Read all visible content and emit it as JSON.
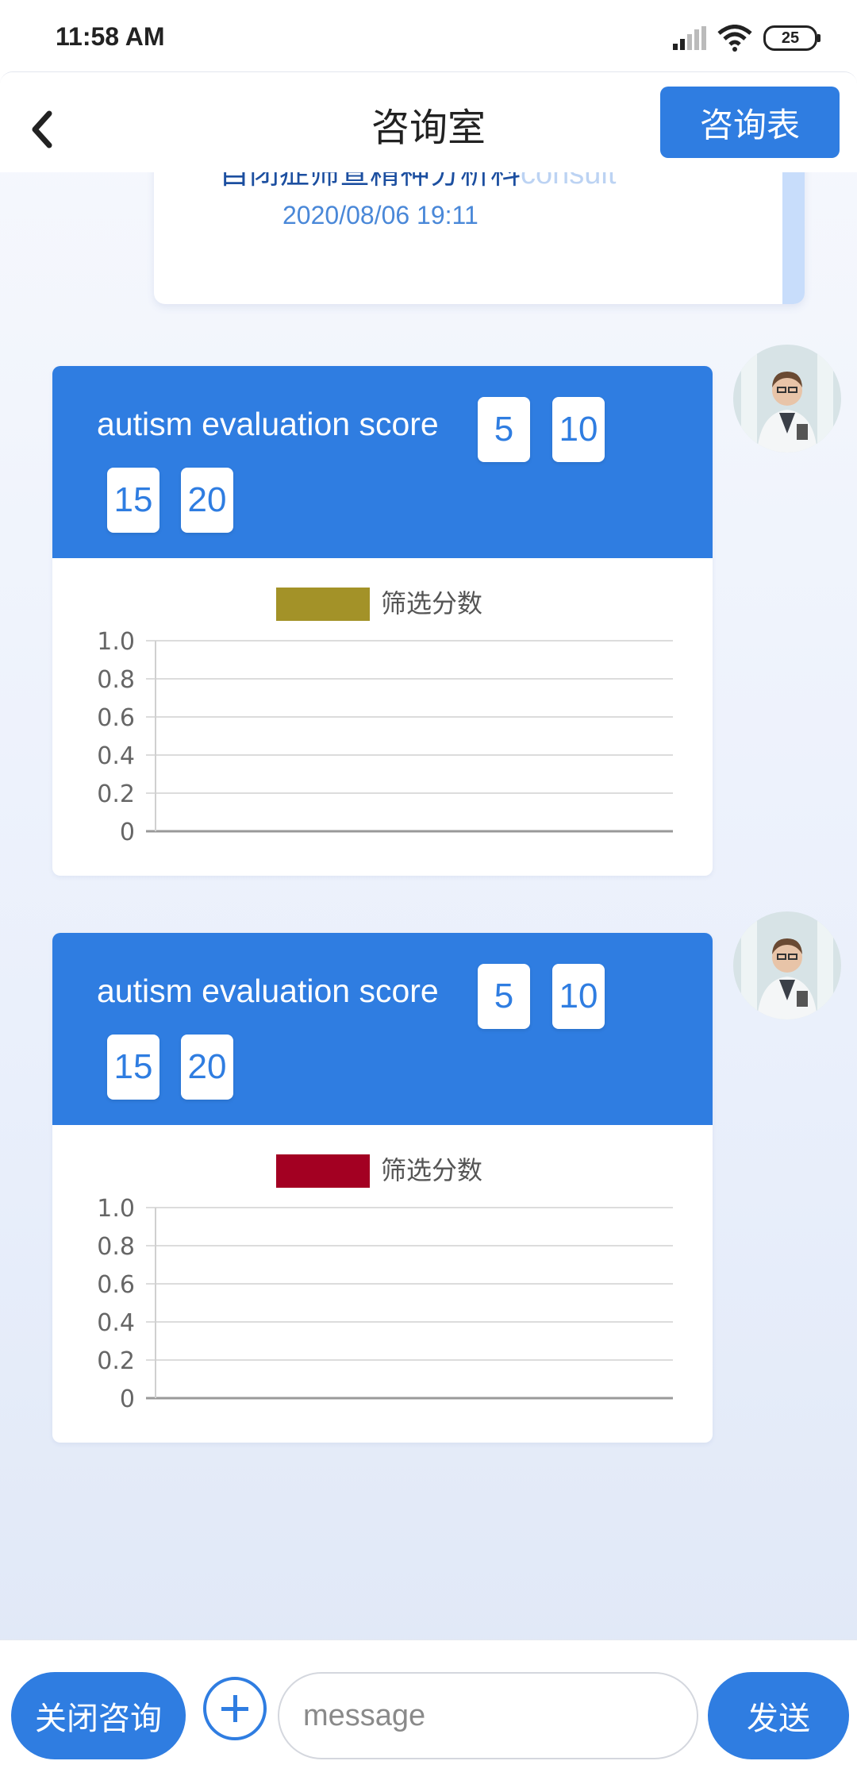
{
  "status_bar": {
    "time": "11:58 AM",
    "battery": "25",
    "signal_icon": "signal-icon",
    "wifi_icon": "wifi-icon"
  },
  "header": {
    "title": "咨询室",
    "form_button": "咨询表",
    "back_icon": "back-chevron-icon"
  },
  "previous_message": {
    "text_visible": "自闭症筛查精神分析科",
    "text_faded": "consult",
    "time": "2020/08/06 19:11"
  },
  "messages": [
    {
      "question": "autism evaluation score",
      "options": [
        "5",
        "10",
        "15",
        "20"
      ],
      "avatar": "doctor-avatar",
      "chart": {
        "legend": "筛选分数",
        "legend_color": "#a39228"
      }
    },
    {
      "question": "autism evaluation score",
      "options": [
        "5",
        "10",
        "15",
        "20"
      ],
      "avatar": "doctor-avatar",
      "chart": {
        "legend": "筛选分数",
        "legend_color": "#a30022"
      }
    }
  ],
  "chart_data": [
    {
      "type": "bar",
      "categories": [],
      "series": [
        {
          "name": "筛选分数",
          "values": []
        }
      ],
      "yticks": [
        "1.0",
        "0.8",
        "0.6",
        "0.4",
        "0.2",
        "0"
      ],
      "ylim": [
        0,
        1.0
      ],
      "grid": true,
      "legend": "top-center",
      "colors": [
        "#a39228"
      ]
    },
    {
      "type": "bar",
      "categories": [],
      "series": [
        {
          "name": "筛选分数",
          "values": []
        }
      ],
      "yticks": [
        "1.0",
        "0.8",
        "0.6",
        "0.4",
        "0.2",
        "0"
      ],
      "ylim": [
        0,
        1.0
      ],
      "grid": true,
      "legend": "top-center",
      "colors": [
        "#a30022"
      ]
    }
  ],
  "input_bar": {
    "close_button": "关闭咨询",
    "placeholder": "message",
    "value": "",
    "send_button": "发送"
  }
}
